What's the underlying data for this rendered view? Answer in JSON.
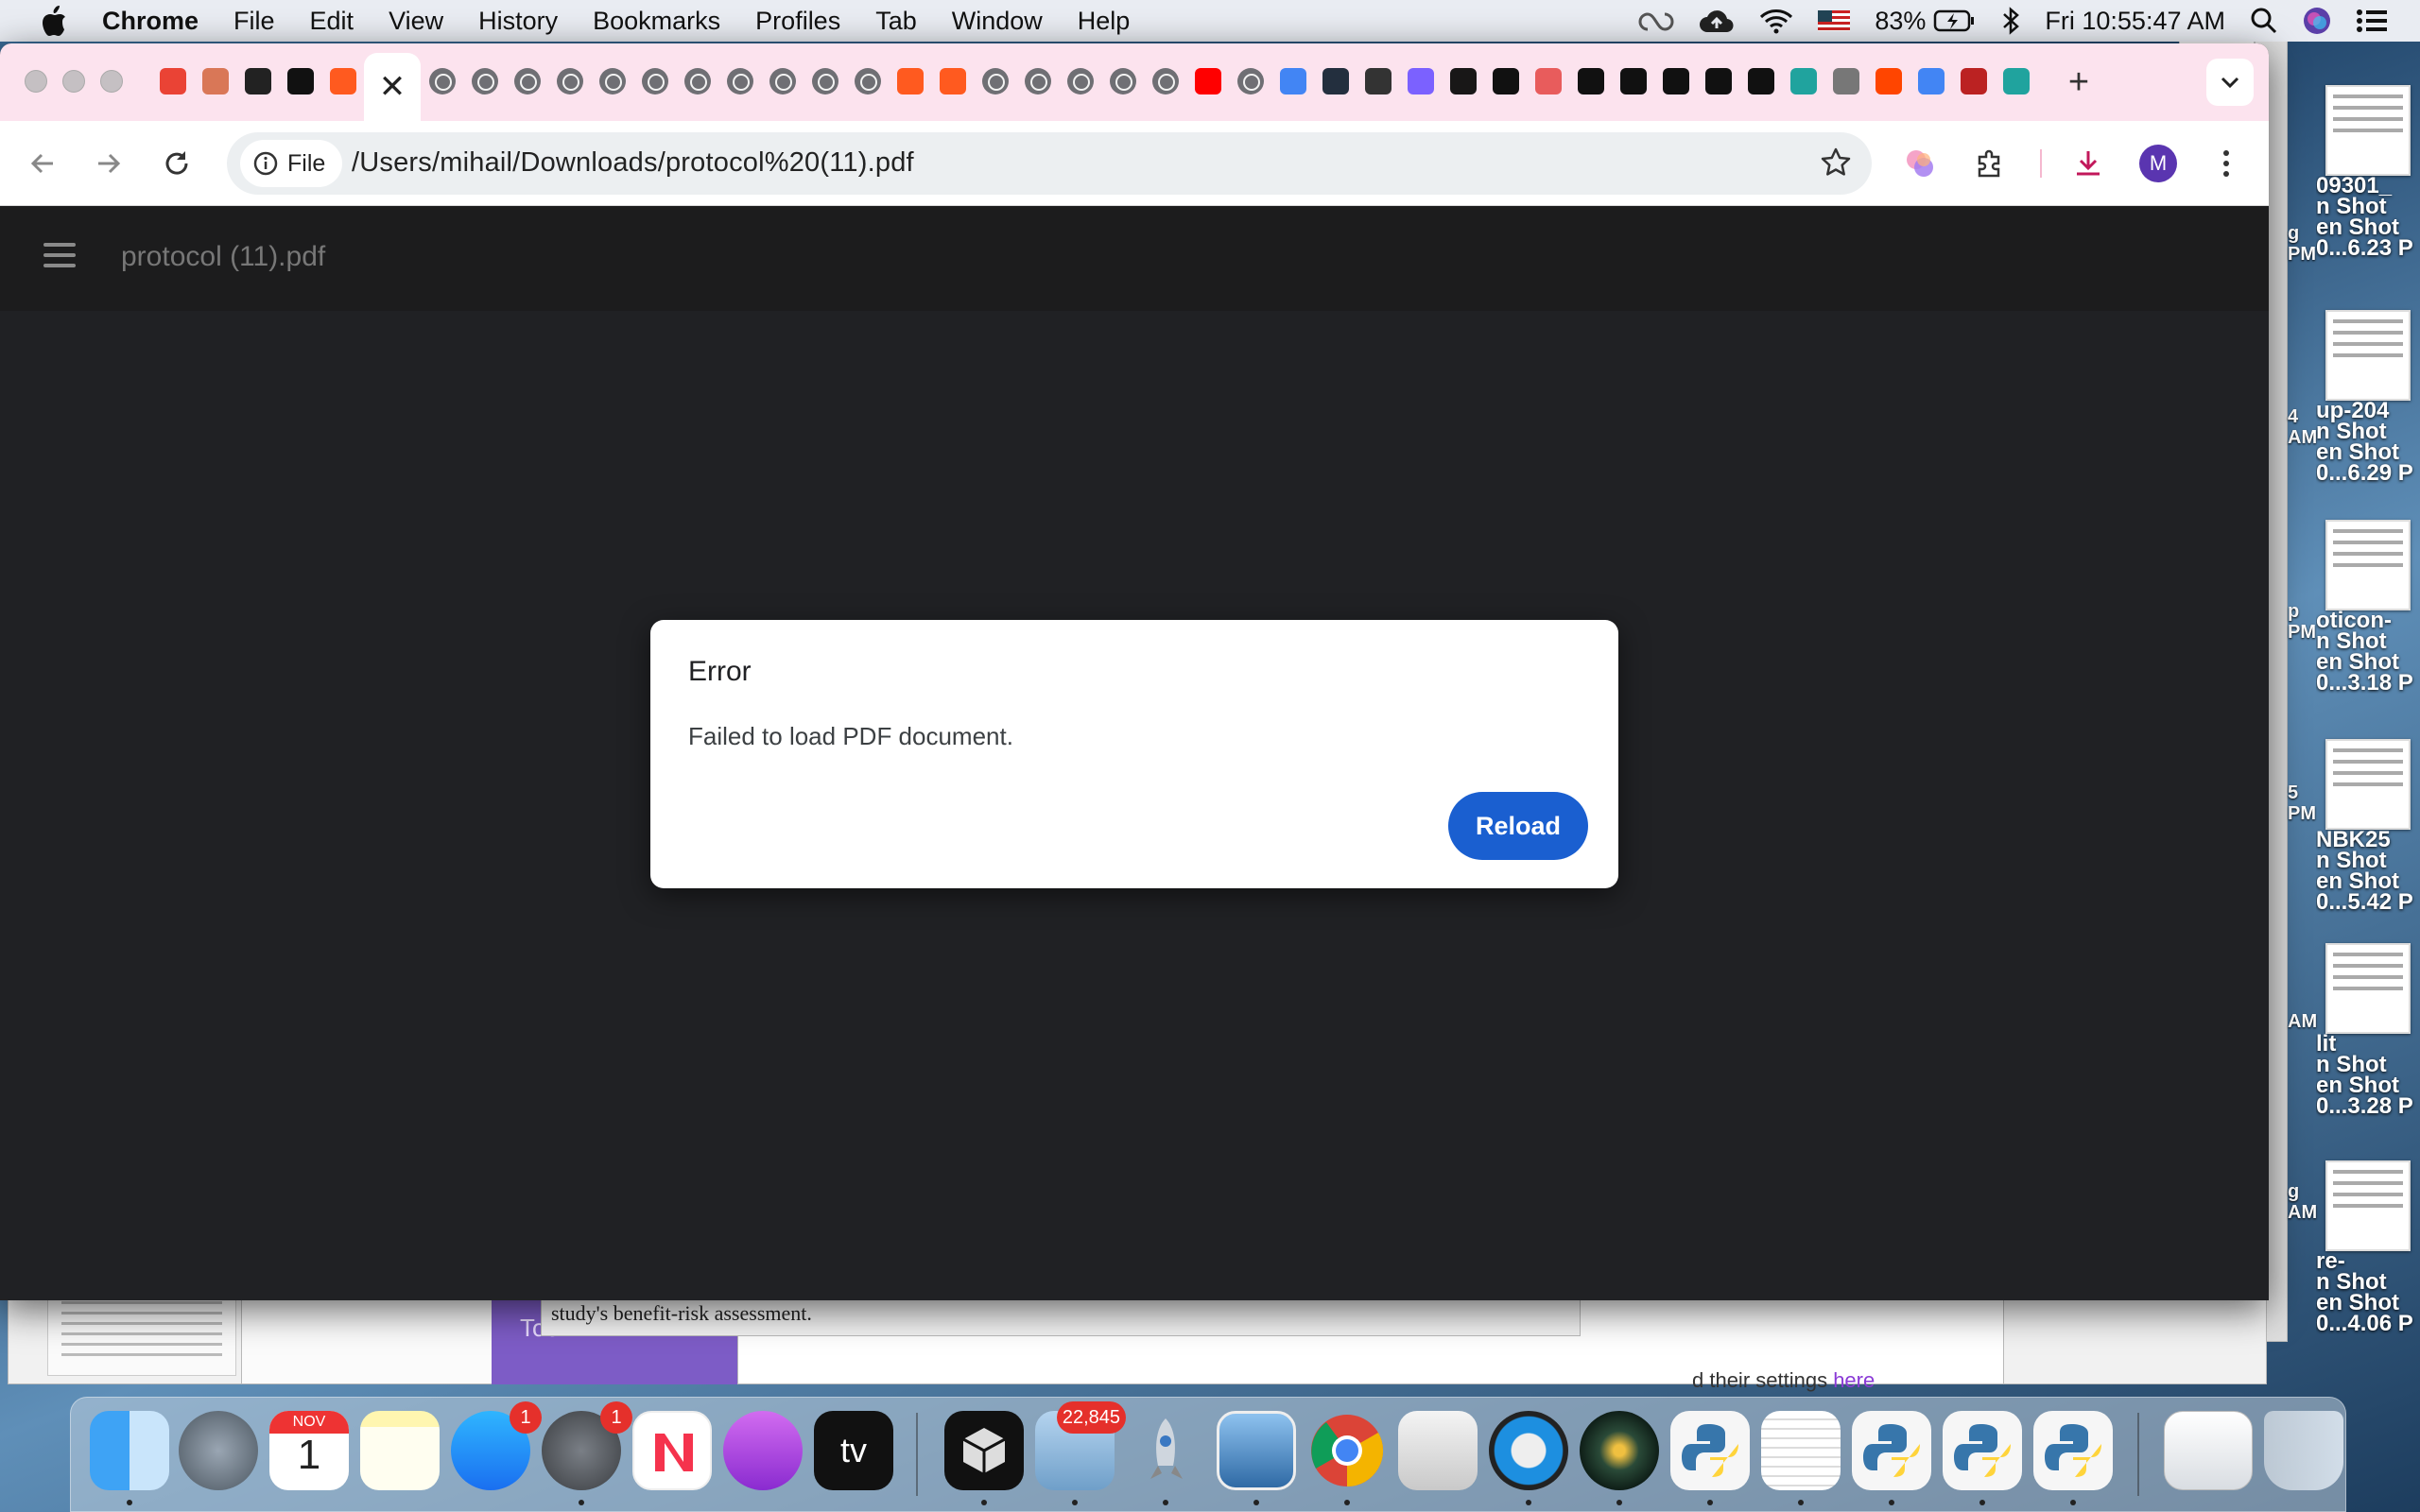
{
  "menubar": {
    "app_name": "Chrome",
    "items": [
      "File",
      "Edit",
      "View",
      "History",
      "Bookmarks",
      "Profiles",
      "Tab",
      "Window",
      "Help"
    ],
    "battery": "83%",
    "clock": "Fri 10:55:47 AM"
  },
  "tabs": {
    "active_close_symbol": "✕",
    "favicons": [
      "gmail",
      "claude",
      "openai",
      "bold-b",
      "orange-arrows",
      "active",
      "globe",
      "globe",
      "globe",
      "globe",
      "globe",
      "globe",
      "globe",
      "globe",
      "globe",
      "globe",
      "globe",
      "orange-arrows",
      "orange-arrows",
      "globe",
      "globe",
      "globe",
      "globe",
      "globe",
      "youtube",
      "globe",
      "google",
      "amazon",
      "perplexity",
      "openai-purple",
      "github",
      "vue-dark",
      "ship",
      "notion-like",
      "openai-dark",
      "openai-dark",
      "notion",
      "notion",
      "shield-teal",
      "chrome",
      "reddit",
      "google",
      "gam",
      "shield-teal"
    ],
    "new_tab_symbol": "+"
  },
  "toolbar": {
    "chip_label": "File",
    "url": "/Users/mihail/Downloads/protocol%20(11).pdf",
    "avatar_letter": "M"
  },
  "pdf": {
    "title": "protocol (11).pdf"
  },
  "dialog": {
    "title": "Error",
    "message": "Failed to load PDF document.",
    "button": "Reload"
  },
  "background": {
    "doc_text": "study's benefit-risk assessment.",
    "tab_fragment": "Too",
    "side_hint_prefix": "d their settings ",
    "side_hint_link": "here"
  },
  "desktop": {
    "labels": [
      "09301_\nn Shot\nen Shot\n0...6.23 P",
      "up-204\nn Shot\nen Shot\n0...6.29 P",
      "oticon-\nn Shot\nen Shot\n0...3.18 P",
      "NBK25\nn Shot\nen Shot\n0...5.42 P",
      "lit\nn Shot\nen Shot\n0...3.28 P",
      "re-\nn Shot\nen Shot\n0...4.06 P"
    ],
    "side_fragments": [
      "g\nPM",
      "4\nAM",
      "p\nPM",
      "5\nPM",
      "AM",
      "g\nAM"
    ]
  },
  "dock": {
    "calendar_month": "NOV",
    "calendar_day": "1",
    "appstore_badge": "1",
    "settings_badge": "1",
    "mail_badge": "22,845",
    "apple_tv_label": "tv"
  },
  "colors": {
    "accent": "#1a5fd0",
    "tabstrip": "#fce3ee",
    "pdf_bg": "#202124"
  }
}
